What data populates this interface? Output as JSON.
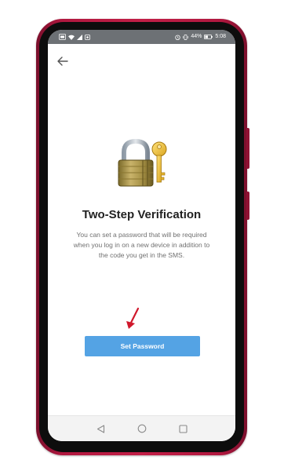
{
  "status_bar": {
    "battery_percent": "44%",
    "time": "5:08",
    "left_icons": [
      "sim-icon",
      "wifi-icon",
      "signal-icon",
      "notification-icon"
    ],
    "right_icons": [
      "alarm-icon",
      "vibrate-icon",
      "battery-icon"
    ]
  },
  "header": {
    "back_icon": "back-arrow-icon"
  },
  "illustration": {
    "icon": "padlock-with-key-icon"
  },
  "content": {
    "title": "Two-Step Verification",
    "description": "You can set a password that will be required when you log in on a new device in addition to the code you get in the SMS.",
    "button_label": "Set Password",
    "button_color": "#54a3e4"
  },
  "annotation": {
    "arrow_color": "#d0182c"
  },
  "nav_bar": {
    "icons": [
      "nav-back-icon",
      "nav-home-icon",
      "nav-recents-icon"
    ]
  },
  "device": {
    "frame_color": "#c21f47"
  }
}
